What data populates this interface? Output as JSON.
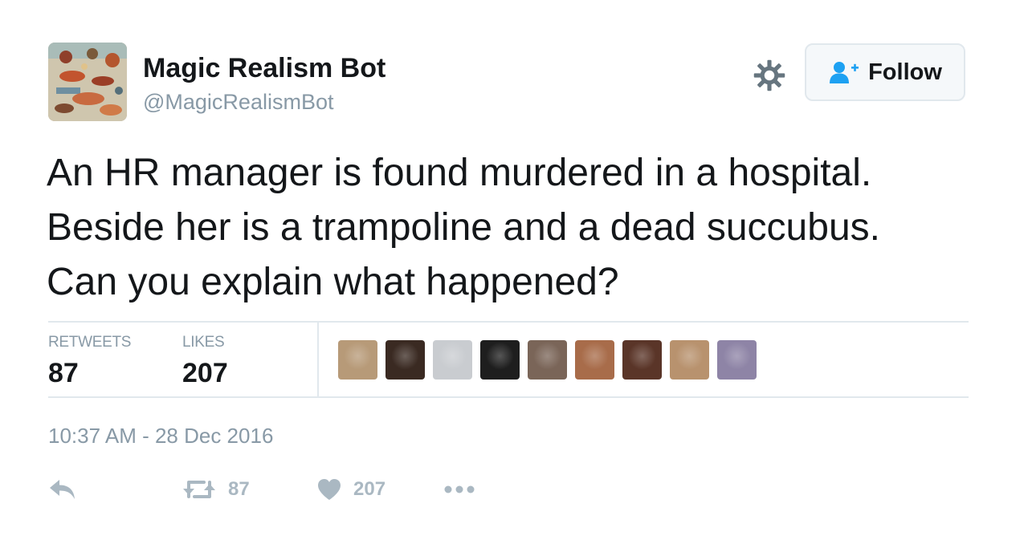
{
  "author": {
    "display_name": "Magic Realism Bot",
    "handle": "@MagicRealismBot",
    "avatar_icon": "ornate-painting-avatar"
  },
  "header": {
    "settings_icon": "gear-icon",
    "follow_label": "Follow",
    "follow_icon": "add-user-icon"
  },
  "tweet": {
    "lines": [
      "An HR manager is found murdered in a hospital.",
      "Beside her is a trampoline and a dead succubus.",
      "Can you explain what happened?"
    ]
  },
  "stats": {
    "retweets_label": "RETWEETS",
    "retweets_count": "87",
    "likes_label": "LIKES",
    "likes_count": "207"
  },
  "likers": [
    {
      "color": "#b79a78"
    },
    {
      "color": "#3a2a22"
    },
    {
      "color": "#c9ccd0"
    },
    {
      "color": "#1e1e1e"
    },
    {
      "color": "#7a6558"
    },
    {
      "color": "#a86c4a"
    },
    {
      "color": "#5a3528"
    },
    {
      "color": "#b8926e"
    },
    {
      "color": "#8e84a6"
    }
  ],
  "timestamp": "10:37 AM - 28 Dec 2016",
  "actions": {
    "reply_icon": "reply-icon",
    "retweet_icon": "retweet-icon",
    "retweet_count": "87",
    "like_icon": "heart-icon",
    "like_count": "207",
    "more_icon": "more-dots-icon"
  },
  "colors": {
    "text": "#14171a",
    "secondary": "#8899a6",
    "action_gray": "#aab8c2",
    "accent": "#1da1f2",
    "border": "#e1e8ed",
    "button_bg": "#f5f8fa"
  }
}
